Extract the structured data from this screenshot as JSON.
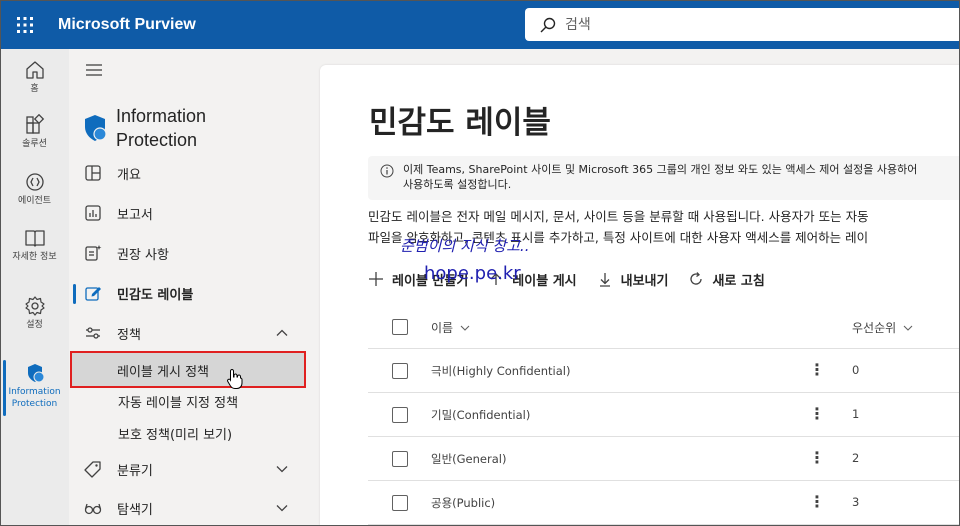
{
  "app": {
    "title": "Microsoft Purview"
  },
  "search": {
    "placeholder": "검색"
  },
  "rail": {
    "items": [
      {
        "label": "홈",
        "icon": "home-icon"
      },
      {
        "label": "솔루션",
        "icon": "solutions-icon"
      },
      {
        "label": "에이전트",
        "icon": "agents-icon"
      },
      {
        "label": "자세한 정보",
        "icon": "book-icon"
      },
      {
        "label": "설정",
        "icon": "gear-icon"
      },
      {
        "label": "Information Protection",
        "icon": "shield-icon",
        "active": true
      }
    ]
  },
  "nav": {
    "header": "Information Protection",
    "items": [
      {
        "label": "개요",
        "icon": "overview-icon"
      },
      {
        "label": "보고서",
        "icon": "report-icon"
      },
      {
        "label": "권장 사항",
        "icon": "recommendation-icon"
      },
      {
        "label": "민감도 레이블",
        "icon": "label-icon",
        "selected": true
      },
      {
        "label": "정책",
        "icon": "policy-icon",
        "expanded": true
      },
      {
        "label": "분류기",
        "icon": "tag-icon"
      },
      {
        "label": "탐색기",
        "icon": "glasses-icon"
      }
    ],
    "policy_sub": [
      {
        "label": "레이블 게시 정책",
        "highlighted": true
      },
      {
        "label": "자동 레이블 지정 정책"
      },
      {
        "label": "보호 정책(미리 보기)"
      }
    ]
  },
  "main": {
    "title": "민감도 레이블",
    "info_line1": "이제 Teams, SharePoint 사이트 및 Microsoft 365 그룹의 개인 정보 와도 있는 액세스 제어 설정을 사용하어",
    "info_line2": "사용하도록 설정합니다.",
    "desc_line1": "민감도 레이블은 전자 메일 메시지, 문서, 사이트 등을 분류할 때 사용됩니다. 사용자가 또는 자동",
    "desc_line2": "파일을 암호화하고, 콘텐츠 표시를 추가하고, 특정 사이트에 대한 사용자 액세스를 제어하는 레이",
    "watermark_text": "준범이의 지식 창고..",
    "watermark_url": "hope.pe.kr",
    "commands": [
      {
        "label": "레이블 만들기",
        "icon": "plus-icon"
      },
      {
        "label": "레이블 게시",
        "icon": "publish-icon"
      },
      {
        "label": "내보내기",
        "icon": "download-icon"
      },
      {
        "label": "새로 고침",
        "icon": "refresh-icon"
      }
    ],
    "table": {
      "headers": {
        "name": "이름",
        "priority": "우선순위"
      },
      "rows": [
        {
          "name": "극비(Highly Confidential)",
          "priority": "0"
        },
        {
          "name": "기밀(Confidential)",
          "priority": "1"
        },
        {
          "name": "일반(General)",
          "priority": "2"
        },
        {
          "name": "공용(Public)",
          "priority": "3"
        }
      ]
    }
  },
  "colors": {
    "topbar": "#0f5ba7",
    "accent": "#0f6cbd",
    "highlight_border": "#e02020",
    "watermark": "#2020b0"
  }
}
